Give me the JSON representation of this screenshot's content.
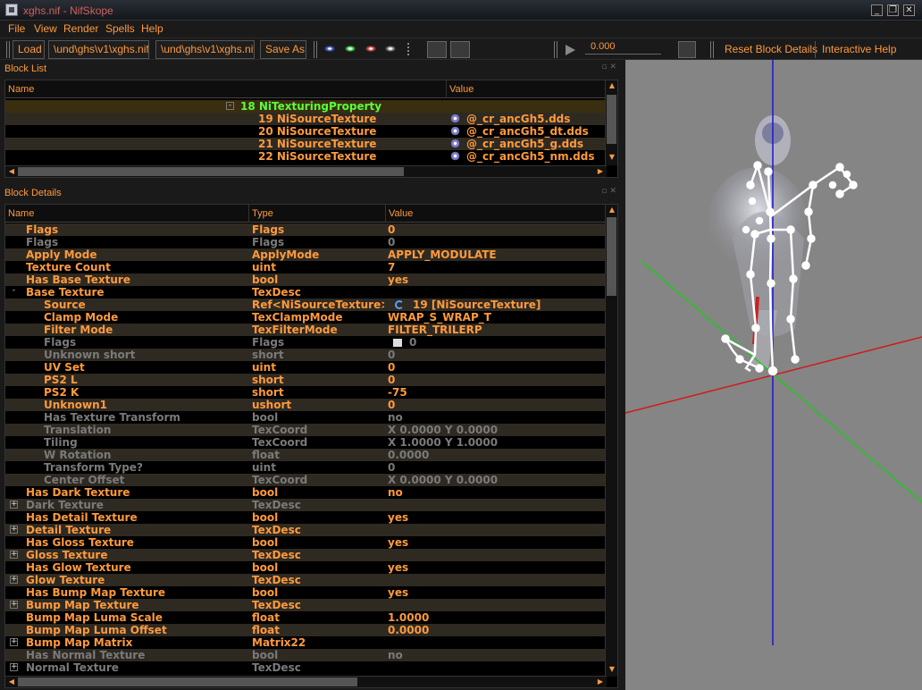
{
  "window": {
    "title": "xghs.nif - NifSkope"
  },
  "menu": [
    "File",
    "View",
    "Render",
    "Spells",
    "Help"
  ],
  "toolbar": {
    "load": "Load",
    "load_path": "\\und\\ghs\\v1\\xghs.nif",
    "save_path": "\\und\\ghs\\v1\\xghs.nif",
    "save_as": "Save As",
    "time_value": "0.000",
    "reset_block": "Reset Block Details",
    "interactive_help": "Interactive Help"
  },
  "block_list": {
    "title": "Block List",
    "columns": [
      "Name",
      "Value"
    ],
    "rows": [
      {
        "name": "18 NiTexturingProperty",
        "value": "",
        "expanded": true
      },
      {
        "name": "19 NiSourceTexture",
        "value": "@_cr_ancGh5.dds"
      },
      {
        "name": "20 NiSourceTexture",
        "value": "@_cr_ancGh5_dt.dds"
      },
      {
        "name": "21 NiSourceTexture",
        "value": "@_cr_ancGh5_g.dds"
      },
      {
        "name": "22 NiSourceTexture",
        "value": "@_cr_ancGh5_nm.dds"
      }
    ]
  },
  "block_details": {
    "title": "Block Details",
    "columns": [
      "Name",
      "Type",
      "Value"
    ],
    "rows": [
      {
        "name": "Flags",
        "type": "Flags",
        "value": "0",
        "indent": 0,
        "active": true
      },
      {
        "name": "Flags",
        "type": "Flags",
        "value": "0",
        "indent": 0,
        "active": false
      },
      {
        "name": "Apply Mode",
        "type": "ApplyMode",
        "value": "APPLY_MODULATE",
        "indent": 0,
        "active": true
      },
      {
        "name": "Texture Count",
        "type": "uint",
        "value": "7",
        "indent": 0,
        "active": true
      },
      {
        "name": "Has Base Texture",
        "type": "bool",
        "value": "yes",
        "indent": 0,
        "active": true
      },
      {
        "name": "Base Texture",
        "type": "TexDesc",
        "value": "",
        "indent": 0,
        "active": true,
        "toggle": "-"
      },
      {
        "name": "Source",
        "type": "Ref<NiSourceTexture>",
        "value": "19 [NiSourceTexture]",
        "indent": 1,
        "active": true,
        "icon": "ref"
      },
      {
        "name": "Clamp Mode",
        "type": "TexClampMode",
        "value": "WRAP_S_WRAP_T",
        "indent": 1,
        "active": true
      },
      {
        "name": "Filter Mode",
        "type": "TexFilterMode",
        "value": "FILTER_TRILERP",
        "indent": 1,
        "active": true
      },
      {
        "name": "Flags",
        "type": "Flags",
        "value": "0",
        "indent": 1,
        "active": false,
        "icon": "flag"
      },
      {
        "name": "Unknown short",
        "type": "short",
        "value": "0",
        "indent": 1,
        "active": false
      },
      {
        "name": "UV Set",
        "type": "uint",
        "value": "0",
        "indent": 1,
        "active": true
      },
      {
        "name": "PS2 L",
        "type": "short",
        "value": "0",
        "indent": 1,
        "active": true
      },
      {
        "name": "PS2 K",
        "type": "short",
        "value": "-75",
        "indent": 1,
        "active": true
      },
      {
        "name": "Unknown1",
        "type": "ushort",
        "value": "0",
        "indent": 1,
        "active": true
      },
      {
        "name": "Has Texture Transform",
        "type": "bool",
        "value": "no",
        "indent": 1,
        "active": false
      },
      {
        "name": "Translation",
        "type": "TexCoord",
        "value": "X 0.0000 Y 0.0000",
        "indent": 1,
        "active": false
      },
      {
        "name": "Tiling",
        "type": "TexCoord",
        "value": "X 1.0000 Y 1.0000",
        "indent": 1,
        "active": false
      },
      {
        "name": "W Rotation",
        "type": "float",
        "value": "0.0000",
        "indent": 1,
        "active": false
      },
      {
        "name": "Transform Type?",
        "type": "uint",
        "value": "0",
        "indent": 1,
        "active": false
      },
      {
        "name": "Center Offset",
        "type": "TexCoord",
        "value": "X 0.0000 Y 0.0000",
        "indent": 1,
        "active": false
      },
      {
        "name": "Has Dark Texture",
        "type": "bool",
        "value": "no",
        "indent": 0,
        "active": true
      },
      {
        "name": "Dark Texture",
        "type": "TexDesc",
        "value": "",
        "indent": 0,
        "active": false,
        "toggle": "+"
      },
      {
        "name": "Has Detail Texture",
        "type": "bool",
        "value": "yes",
        "indent": 0,
        "active": true
      },
      {
        "name": "Detail Texture",
        "type": "TexDesc",
        "value": "",
        "indent": 0,
        "active": true,
        "toggle": "+"
      },
      {
        "name": "Has Gloss Texture",
        "type": "bool",
        "value": "yes",
        "indent": 0,
        "active": true
      },
      {
        "name": "Gloss Texture",
        "type": "TexDesc",
        "value": "",
        "indent": 0,
        "active": true,
        "toggle": "+"
      },
      {
        "name": "Has Glow Texture",
        "type": "bool",
        "value": "yes",
        "indent": 0,
        "active": true
      },
      {
        "name": "Glow Texture",
        "type": "TexDesc",
        "value": "",
        "indent": 0,
        "active": true,
        "toggle": "+"
      },
      {
        "name": "Has Bump Map Texture",
        "type": "bool",
        "value": "yes",
        "indent": 0,
        "active": true
      },
      {
        "name": "Bump Map Texture",
        "type": "TexDesc",
        "value": "",
        "indent": 0,
        "active": true,
        "toggle": "+"
      },
      {
        "name": "Bump Map Luma Scale",
        "type": "float",
        "value": "1.0000",
        "indent": 0,
        "active": true
      },
      {
        "name": "Bump Map Luma Offset",
        "type": "float",
        "value": "0.0000",
        "indent": 0,
        "active": true
      },
      {
        "name": "Bump Map Matrix",
        "type": "Matrix22",
        "value": "",
        "indent": 0,
        "active": true,
        "toggle": "+"
      },
      {
        "name": "Has Normal Texture",
        "type": "bool",
        "value": "no",
        "indent": 0,
        "active": false
      },
      {
        "name": "Normal Texture",
        "type": "TexDesc",
        "value": "",
        "indent": 0,
        "active": false,
        "toggle": "+"
      }
    ]
  },
  "colors": {
    "accent": "#ff9a3c",
    "inactive": "#7a7a7a",
    "selected_block": "#5aff3a",
    "viewport_bg": "#858585"
  }
}
